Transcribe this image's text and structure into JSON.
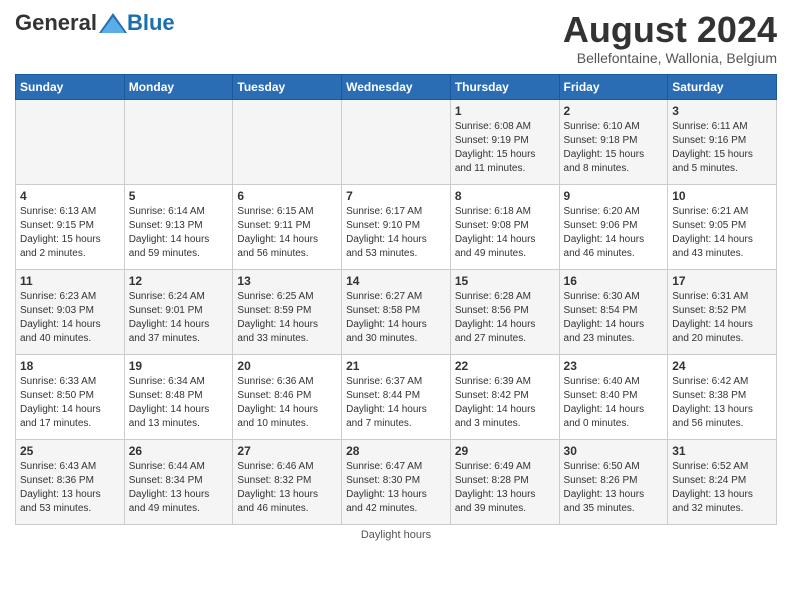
{
  "header": {
    "logo_general": "General",
    "logo_blue": "Blue",
    "month_title": "August 2024",
    "location": "Bellefontaine, Wallonia, Belgium"
  },
  "days_of_week": [
    "Sunday",
    "Monday",
    "Tuesday",
    "Wednesday",
    "Thursday",
    "Friday",
    "Saturday"
  ],
  "footer": "Daylight hours",
  "weeks": [
    [
      {
        "day": "",
        "info": ""
      },
      {
        "day": "",
        "info": ""
      },
      {
        "day": "",
        "info": ""
      },
      {
        "day": "",
        "info": ""
      },
      {
        "day": "1",
        "info": "Sunrise: 6:08 AM\nSunset: 9:19 PM\nDaylight: 15 hours\nand 11 minutes."
      },
      {
        "day": "2",
        "info": "Sunrise: 6:10 AM\nSunset: 9:18 PM\nDaylight: 15 hours\nand 8 minutes."
      },
      {
        "day": "3",
        "info": "Sunrise: 6:11 AM\nSunset: 9:16 PM\nDaylight: 15 hours\nand 5 minutes."
      }
    ],
    [
      {
        "day": "4",
        "info": "Sunrise: 6:13 AM\nSunset: 9:15 PM\nDaylight: 15 hours\nand 2 minutes."
      },
      {
        "day": "5",
        "info": "Sunrise: 6:14 AM\nSunset: 9:13 PM\nDaylight: 14 hours\nand 59 minutes."
      },
      {
        "day": "6",
        "info": "Sunrise: 6:15 AM\nSunset: 9:11 PM\nDaylight: 14 hours\nand 56 minutes."
      },
      {
        "day": "7",
        "info": "Sunrise: 6:17 AM\nSunset: 9:10 PM\nDaylight: 14 hours\nand 53 minutes."
      },
      {
        "day": "8",
        "info": "Sunrise: 6:18 AM\nSunset: 9:08 PM\nDaylight: 14 hours\nand 49 minutes."
      },
      {
        "day": "9",
        "info": "Sunrise: 6:20 AM\nSunset: 9:06 PM\nDaylight: 14 hours\nand 46 minutes."
      },
      {
        "day": "10",
        "info": "Sunrise: 6:21 AM\nSunset: 9:05 PM\nDaylight: 14 hours\nand 43 minutes."
      }
    ],
    [
      {
        "day": "11",
        "info": "Sunrise: 6:23 AM\nSunset: 9:03 PM\nDaylight: 14 hours\nand 40 minutes."
      },
      {
        "day": "12",
        "info": "Sunrise: 6:24 AM\nSunset: 9:01 PM\nDaylight: 14 hours\nand 37 minutes."
      },
      {
        "day": "13",
        "info": "Sunrise: 6:25 AM\nSunset: 8:59 PM\nDaylight: 14 hours\nand 33 minutes."
      },
      {
        "day": "14",
        "info": "Sunrise: 6:27 AM\nSunset: 8:58 PM\nDaylight: 14 hours\nand 30 minutes."
      },
      {
        "day": "15",
        "info": "Sunrise: 6:28 AM\nSunset: 8:56 PM\nDaylight: 14 hours\nand 27 minutes."
      },
      {
        "day": "16",
        "info": "Sunrise: 6:30 AM\nSunset: 8:54 PM\nDaylight: 14 hours\nand 23 minutes."
      },
      {
        "day": "17",
        "info": "Sunrise: 6:31 AM\nSunset: 8:52 PM\nDaylight: 14 hours\nand 20 minutes."
      }
    ],
    [
      {
        "day": "18",
        "info": "Sunrise: 6:33 AM\nSunset: 8:50 PM\nDaylight: 14 hours\nand 17 minutes."
      },
      {
        "day": "19",
        "info": "Sunrise: 6:34 AM\nSunset: 8:48 PM\nDaylight: 14 hours\nand 13 minutes."
      },
      {
        "day": "20",
        "info": "Sunrise: 6:36 AM\nSunset: 8:46 PM\nDaylight: 14 hours\nand 10 minutes."
      },
      {
        "day": "21",
        "info": "Sunrise: 6:37 AM\nSunset: 8:44 PM\nDaylight: 14 hours\nand 7 minutes."
      },
      {
        "day": "22",
        "info": "Sunrise: 6:39 AM\nSunset: 8:42 PM\nDaylight: 14 hours\nand 3 minutes."
      },
      {
        "day": "23",
        "info": "Sunrise: 6:40 AM\nSunset: 8:40 PM\nDaylight: 14 hours\nand 0 minutes."
      },
      {
        "day": "24",
        "info": "Sunrise: 6:42 AM\nSunset: 8:38 PM\nDaylight: 13 hours\nand 56 minutes."
      }
    ],
    [
      {
        "day": "25",
        "info": "Sunrise: 6:43 AM\nSunset: 8:36 PM\nDaylight: 13 hours\nand 53 minutes."
      },
      {
        "day": "26",
        "info": "Sunrise: 6:44 AM\nSunset: 8:34 PM\nDaylight: 13 hours\nand 49 minutes."
      },
      {
        "day": "27",
        "info": "Sunrise: 6:46 AM\nSunset: 8:32 PM\nDaylight: 13 hours\nand 46 minutes."
      },
      {
        "day": "28",
        "info": "Sunrise: 6:47 AM\nSunset: 8:30 PM\nDaylight: 13 hours\nand 42 minutes."
      },
      {
        "day": "29",
        "info": "Sunrise: 6:49 AM\nSunset: 8:28 PM\nDaylight: 13 hours\nand 39 minutes."
      },
      {
        "day": "30",
        "info": "Sunrise: 6:50 AM\nSunset: 8:26 PM\nDaylight: 13 hours\nand 35 minutes."
      },
      {
        "day": "31",
        "info": "Sunrise: 6:52 AM\nSunset: 8:24 PM\nDaylight: 13 hours\nand 32 minutes."
      }
    ]
  ]
}
